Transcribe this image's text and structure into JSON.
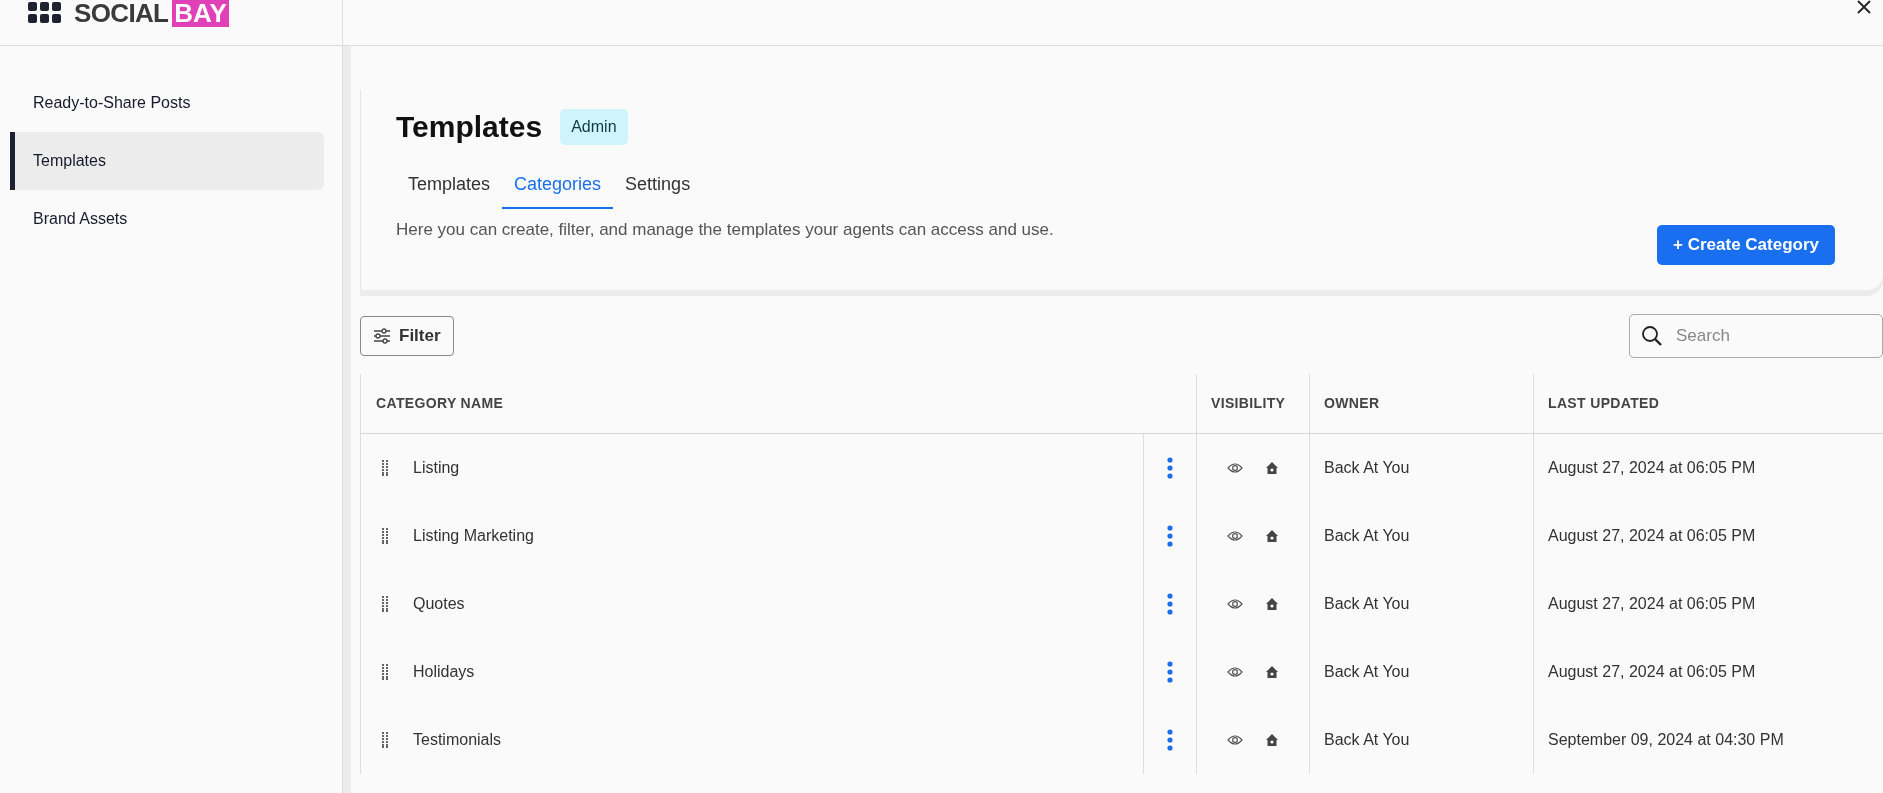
{
  "logo": {
    "text": "SOCIAL",
    "highlight": "BAY"
  },
  "sidebar": {
    "items": [
      {
        "label": "Ready-to-Share Posts",
        "selected": false
      },
      {
        "label": "Templates",
        "selected": true
      },
      {
        "label": "Brand Assets",
        "selected": false
      }
    ]
  },
  "header": {
    "title": "Templates",
    "badge": "Admin",
    "tabs": [
      {
        "label": "Templates",
        "selected": false
      },
      {
        "label": "Categories",
        "selected": true
      },
      {
        "label": "Settings",
        "selected": false
      }
    ],
    "description": "Here you can create, filter, and manage the templates your agents can access and use.",
    "create_button": "+ Create Category"
  },
  "toolbar": {
    "filter_button": "Filter",
    "search": {
      "placeholder": "Search"
    }
  },
  "table": {
    "columns": [
      "CATEGORY NAME",
      "VISIBILITY",
      "OWNER",
      "LAST UPDATED"
    ],
    "rows": [
      {
        "name": "Listing",
        "owner": "Back At You",
        "last_updated": "August 27, 2024 at 06:05 PM"
      },
      {
        "name": "Listing Marketing",
        "owner": "Back At You",
        "last_updated": "August 27, 2024 at 06:05 PM"
      },
      {
        "name": "Quotes",
        "owner": "Back At You",
        "last_updated": "August 27, 2024 at 06:05 PM"
      },
      {
        "name": "Holidays",
        "owner": "Back At You",
        "last_updated": "August 27, 2024 at 06:05 PM"
      },
      {
        "name": "Testimonials",
        "owner": "Back At You",
        "last_updated": "September 09, 2024 at 04:30 PM"
      }
    ]
  }
}
